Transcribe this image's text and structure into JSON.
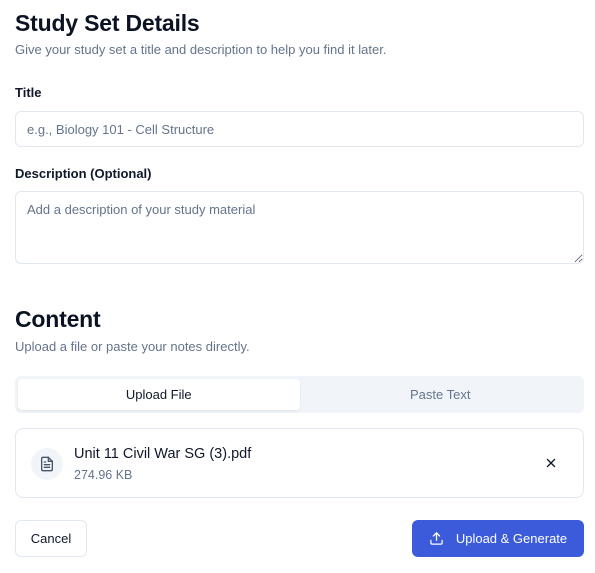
{
  "details": {
    "title": "Study Set Details",
    "subtitle": "Give your study set a title and description to help you find it later.",
    "title_label": "Title",
    "title_placeholder": "e.g., Biology 101 - Cell Structure",
    "title_value": "",
    "description_label": "Description (Optional)",
    "description_placeholder": "Add a description of your study material",
    "description_value": ""
  },
  "content": {
    "title": "Content",
    "subtitle": "Upload a file or paste your notes directly.",
    "tabs": [
      {
        "label": "Upload File",
        "active": true
      },
      {
        "label": "Paste Text",
        "active": false
      }
    ],
    "file": {
      "icon": "file-text-icon",
      "name": "Unit 11 Civil War SG (3).pdf",
      "size": "274.96 KB"
    }
  },
  "actions": {
    "cancel_label": "Cancel",
    "primary_label": "Upload & Generate",
    "primary_icon": "upload-icon"
  },
  "colors": {
    "primary": "#3b5bdb",
    "muted_text": "#64748b",
    "border": "#e2e8f0",
    "tab_bg": "#f1f5f9"
  }
}
